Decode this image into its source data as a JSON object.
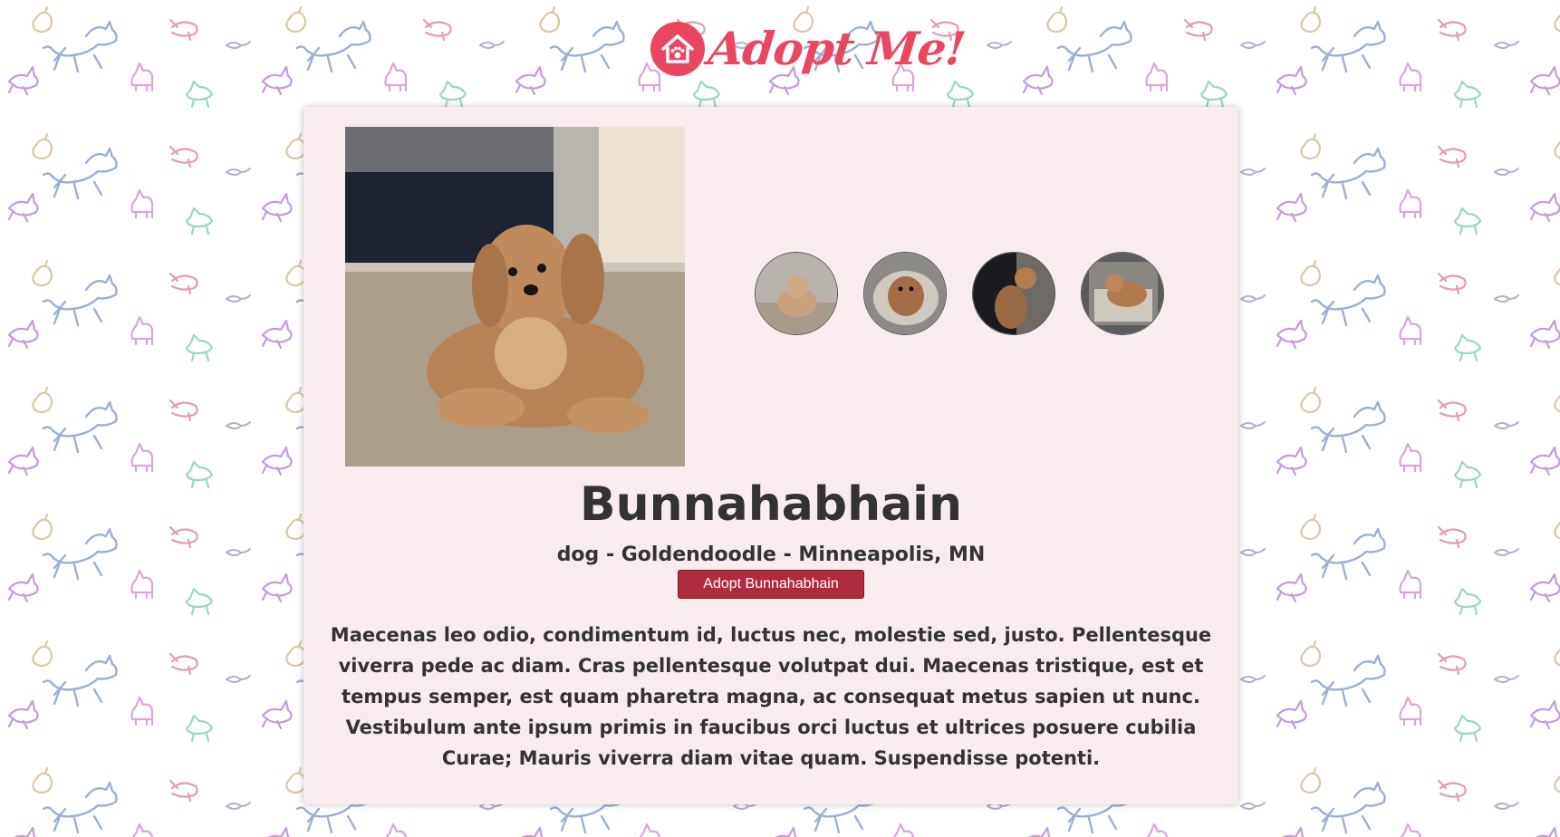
{
  "header": {
    "logo_text": "Adopt Me!"
  },
  "pet": {
    "name": "Bunnahabhain",
    "meta": "dog - Goldendoodle - Minneapolis, MN",
    "adopt_button_label": "Adopt Bunnahabhain",
    "description": "Maecenas leo odio, condimentum id, luctus nec, molestie sed, justo. Pellentesque viverra pede ac diam. Cras pellentesque volutpat dui. Maecenas tristique, est et tempus semper, est quam pharetra magna, ac consequat metus sapien ut nunc. Vestibulum ante ipsum primis in faucibus orci luctus et ultrices posuere cubilia Curae; Mauris viverra diam vitae quam. Suspendisse potenti."
  },
  "colors": {
    "brand": "#e8475f",
    "card_background": "#f8ecee",
    "adopt_button": "#b02b3e",
    "text": "#333333"
  },
  "icons": {
    "logo": "house-paw-icon"
  }
}
